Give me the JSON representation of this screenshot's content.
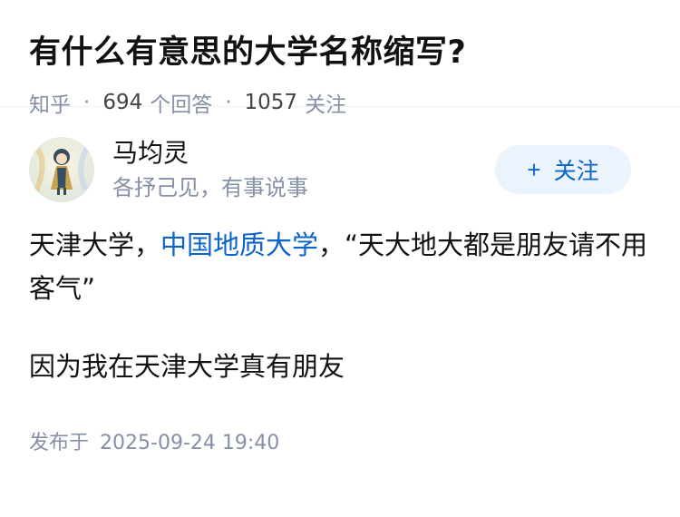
{
  "question": {
    "title": "有什么有意思的大学名称缩写?",
    "source": "知乎",
    "answer_count": "694",
    "answer_label": "个回答",
    "follow_count": "1057",
    "follow_label": "关注"
  },
  "author": {
    "name": "马均灵",
    "bio": "各抒己见，有事说事",
    "follow_label": "关注"
  },
  "content": {
    "p1_before": "天津大学，",
    "p1_link": "中国地质大学",
    "p1_after": "，“天大地大都是朋友请不用客气”",
    "p2": "因为我在天津大学真有朋友"
  },
  "published": {
    "label": "发布于",
    "time": "2025-09-24 19:40"
  }
}
